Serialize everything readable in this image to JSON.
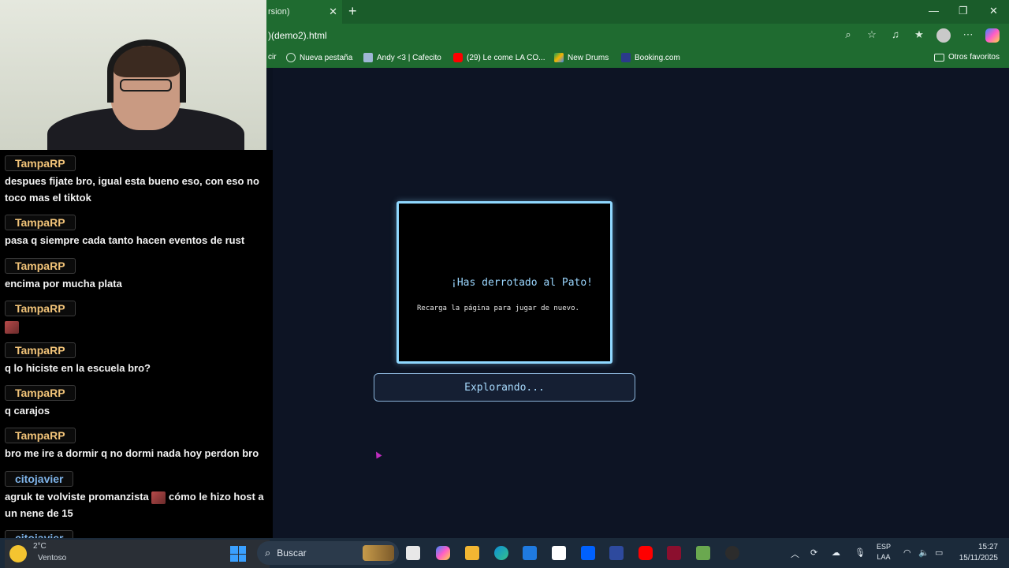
{
  "browser": {
    "tab_title": "rsion)",
    "url": ")(demo2).html",
    "bookmarks": [
      {
        "label": "cir",
        "icon": "bookmark-partial-icon",
        "color": "#1f6b30"
      },
      {
        "label": "Nueva pestaña",
        "icon": "globe-icon",
        "color": "#cfe3d4"
      },
      {
        "label": "Andy <3 | Cafecito",
        "icon": "page-icon",
        "color": "#9fb7d6"
      },
      {
        "label": "(29) Le come LA CO...",
        "icon": "youtube-icon",
        "color": "#ff0000"
      },
      {
        "label": "New Drums",
        "icon": "drive-icon",
        "color": "#f4b400"
      },
      {
        "label": "Booking.com",
        "icon": "booking-icon",
        "color": "#2b3a8a"
      }
    ],
    "other_favorites": "Otros favoritos"
  },
  "chat": {
    "messages": [
      {
        "user": "TampaRP",
        "text": "despues fijate bro, igual esta bueno eso, con eso no toco mas el tiktok",
        "user_color": "#f2c479"
      },
      {
        "user": "TampaRP",
        "text": "pasa q siempre cada tanto hacen eventos de rust",
        "user_color": "#f2c479"
      },
      {
        "user": "TampaRP",
        "text": "encima por mucha plata",
        "user_color": "#f2c479"
      },
      {
        "user": "TampaRP",
        "text": "",
        "emote": "emote-icon",
        "user_color": "#f2c479"
      },
      {
        "user": "TampaRP",
        "text": "q lo hiciste en la escuela bro?",
        "user_color": "#f2c479"
      },
      {
        "user": "TampaRP",
        "text": "q carajos",
        "user_color": "#f2c479"
      },
      {
        "user": "TampaRP",
        "text": "bro me ire a dormir q no dormi nada hoy perdon bro",
        "user_color": "#f2c479"
      },
      {
        "user": "citojavier",
        "text_a": "agruk te volviste promanzista",
        "text_b": "cómo le hizo host a un nene de 15",
        "user_color": "#7fb4ea"
      },
      {
        "user": "citojavier",
        "text": "",
        "user_color": "#7fb4ea"
      }
    ]
  },
  "game": {
    "dialog_title": "¡Has derrotado al Pato!",
    "dialog_subtitle": "Recarga la página para jugar de nuevo.",
    "status_button": "Explorando..."
  },
  "taskbar": {
    "weather_line1": "2°C",
    "weather_line2": "Ventoso",
    "search_label": "Buscar",
    "lang_line1": "ESP",
    "lang_line2": "LAA",
    "time": "15:27",
    "date": "15/11/2025"
  }
}
